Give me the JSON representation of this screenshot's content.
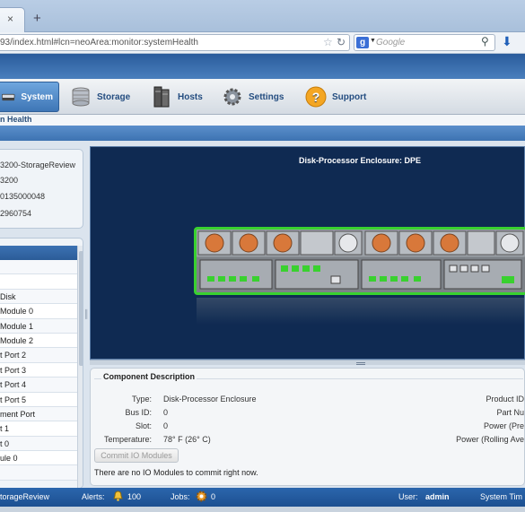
{
  "browser": {
    "tab_close": "×",
    "new_tab": "+",
    "url": "93/index.html#lcn=neoArea:monitor:systemHealth",
    "search_placeholder": "Google",
    "search_engine_letter": "g"
  },
  "menu": {
    "items": [
      {
        "label": "System",
        "icon": "system-icon",
        "active": true
      },
      {
        "label": "Storage",
        "icon": "storage-icon"
      },
      {
        "label": "Hosts",
        "icon": "hosts-icon"
      },
      {
        "label": "Settings",
        "icon": "settings-icon"
      },
      {
        "label": "Support",
        "icon": "support-icon"
      }
    ]
  },
  "breadcrumb": "n Health",
  "system_info": {
    "lines": [
      "3200-StorageReview",
      "3200",
      "0135000048",
      "2960754"
    ]
  },
  "tree": {
    "rows": [
      "",
      "",
      " Disk",
      " Module 0",
      " Module 1",
      " Module 2",
      "t Port 2",
      "t Port 3",
      "t Port 4",
      "t Port 5",
      "ment Port",
      "t 1",
      "t 0",
      "ule 0",
      ""
    ]
  },
  "viewer": {
    "title": "Disk-Processor Enclosure: DPE"
  },
  "component": {
    "title": "Component Description",
    "left": [
      {
        "key": "Type:",
        "value": "Disk-Processor Enclosure"
      },
      {
        "key": "Bus ID:",
        "value": "0"
      },
      {
        "key": "Slot:",
        "value": "0"
      },
      {
        "key": "Temperature:",
        "value": "78° F (26° C)"
      }
    ],
    "right": [
      "Product ID",
      "Part Nu",
      "Power (Pre",
      "Power (Rolling Ave"
    ],
    "commit_button": "Commit IO Modules",
    "commit_note": "There are no IO Modules to commit right now."
  },
  "status": {
    "system_name": "torageReview",
    "alerts_label": "Alerts:",
    "alerts_count": "100",
    "jobs_label": "Jobs:",
    "jobs_count": "0",
    "user_label": "User:",
    "user_name": "admin",
    "system_time_label": "System Tim"
  },
  "colors": {
    "accent": "#2b66ad",
    "enclosure_border": "#39d12f",
    "viewer_bg": "#0f2a52"
  }
}
